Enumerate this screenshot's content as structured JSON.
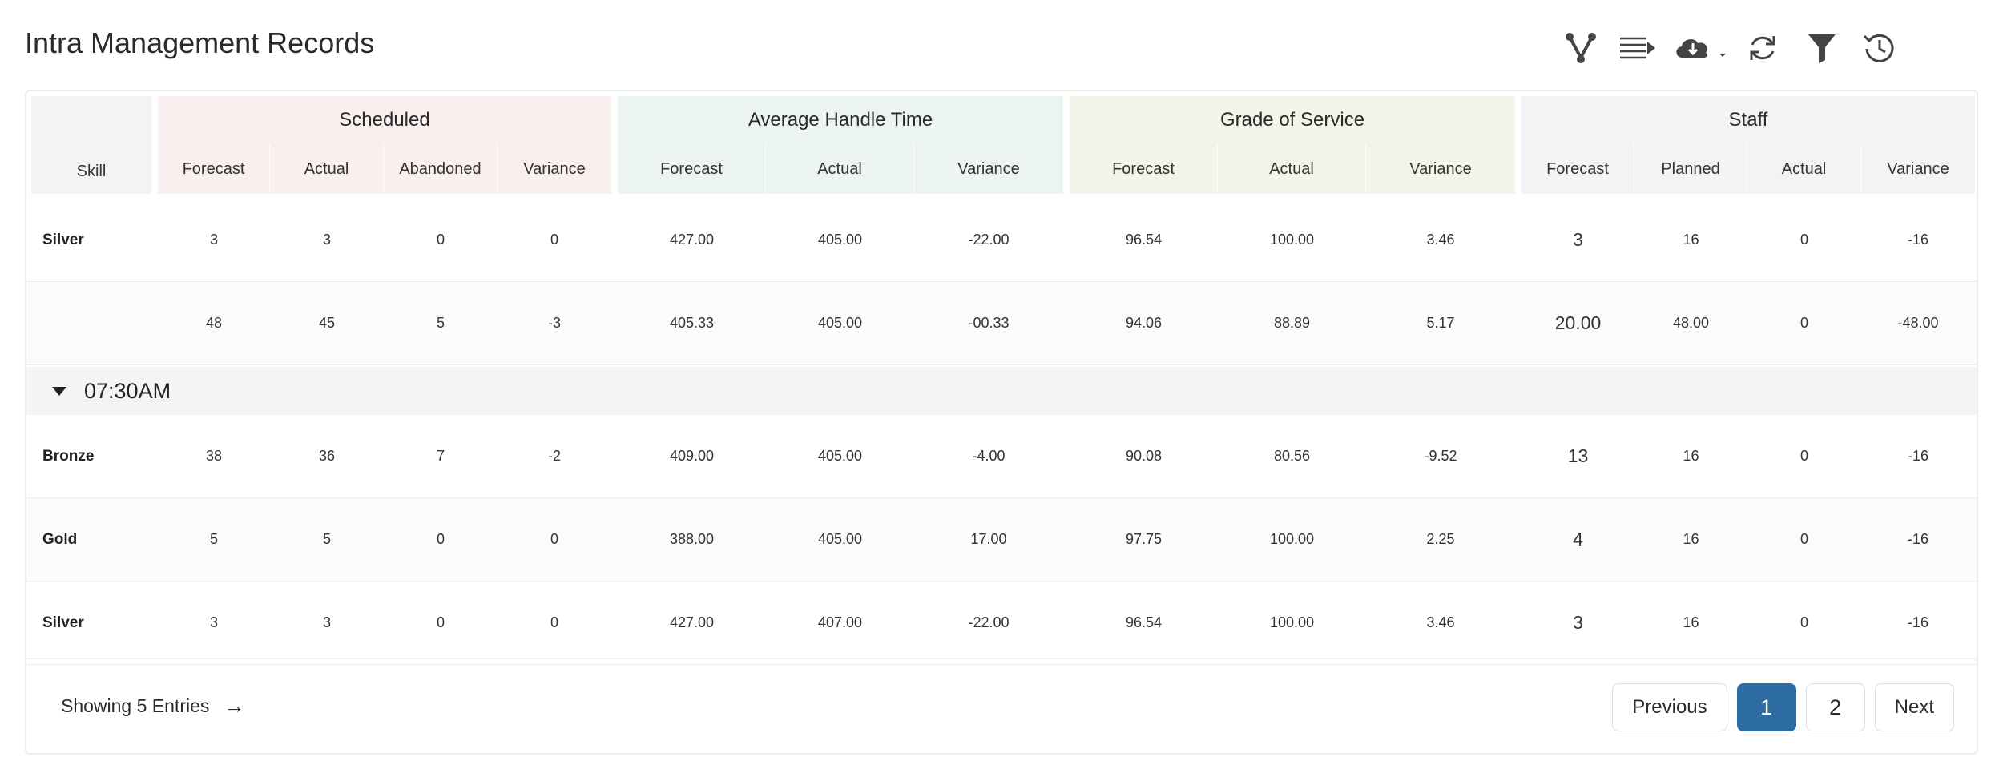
{
  "page": {
    "title": "Intra Management Records"
  },
  "toolbar": {
    "icons": [
      "branch-icon",
      "queue-list-icon",
      "cloud-download-icon",
      "refresh-icon",
      "filter-icon",
      "history-icon"
    ]
  },
  "table": {
    "skill_header": "Skill",
    "groups": {
      "scheduled": "Scheduled",
      "aht": "Average Handle Time",
      "gos": "Grade of Service",
      "staff": "Staff"
    },
    "sub": {
      "scheduled": [
        "Forecast",
        "Actual",
        "Abandoned",
        "Variance"
      ],
      "aht": [
        "Forecast",
        "Actual",
        "Variance"
      ],
      "gos": [
        "Forecast",
        "Actual",
        "Variance"
      ],
      "staff": [
        "Forecast",
        "Planned",
        "Actual",
        "Variance"
      ]
    },
    "rows_a": [
      {
        "skill": "Silver",
        "v": [
          "3",
          "3",
          "0",
          "0",
          "427.00",
          "405.00",
          "-22.00",
          "96.54",
          "100.00",
          "3.46",
          "3",
          "16",
          "0",
          "-16"
        ]
      },
      {
        "skill": "",
        "v": [
          "48",
          "45",
          "5",
          "-3",
          "405.33",
          "405.00",
          "-00.33",
          "94.06",
          "88.89",
          "5.17",
          "20.00",
          "48.00",
          "0",
          "-48.00"
        ]
      }
    ],
    "group_label": "07:30AM",
    "rows_b": [
      {
        "skill": "Bronze",
        "v": [
          "38",
          "36",
          "7",
          "-2",
          "409.00",
          "405.00",
          "-4.00",
          "90.08",
          "80.56",
          "-9.52",
          "13",
          "16",
          "0",
          "-16"
        ]
      },
      {
        "skill": "Gold",
        "v": [
          "5",
          "5",
          "0",
          "0",
          "388.00",
          "405.00",
          "17.00",
          "97.75",
          "100.00",
          "2.25",
          "4",
          "16",
          "0",
          "-16"
        ]
      },
      {
        "skill": "Silver",
        "v": [
          "3",
          "3",
          "0",
          "0",
          "427.00",
          "407.00",
          "-22.00",
          "96.54",
          "100.00",
          "3.46",
          "3",
          "16",
          "0",
          "-16"
        ]
      }
    ]
  },
  "footer": {
    "showing": "Showing 5 Entries",
    "arrow": "→",
    "previous": "Previous",
    "pages": [
      "1",
      "2"
    ],
    "active_page": "1",
    "next": "Next"
  },
  "colors": {
    "skill_bg": "#f2f3f5",
    "scheduled_bg": "#f9efef",
    "aht_bg": "#ebf4ef",
    "gos_bg": "#f4f3e8",
    "staff_bg": "#f2f3f5",
    "active_page": "#2e6da4"
  }
}
